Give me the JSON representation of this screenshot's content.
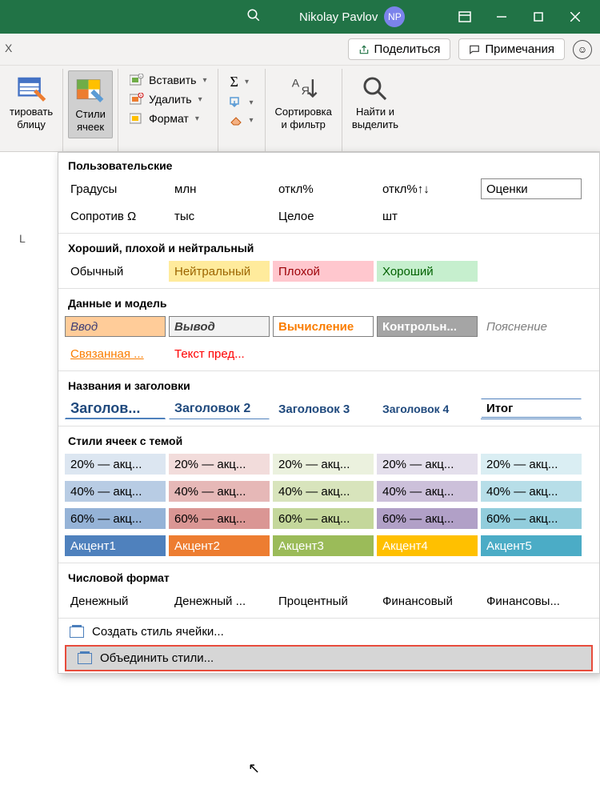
{
  "titlebar": {
    "user": "Nikolay Pavlov",
    "initials": "NP"
  },
  "top": {
    "share": "Поделиться",
    "comments": "Примечания",
    "x": "X"
  },
  "ribbon": {
    "format_table": "тировать\nблицу",
    "cell_styles": "Стили\nячеек",
    "insert": "Вставить",
    "delete": "Удалить",
    "format": "Формат",
    "sort": "Сортировка\nи фильтр",
    "find": "Найти и\nвыделить"
  },
  "col_l": "L",
  "sections": {
    "custom": "Пользовательские",
    "custom_row1": [
      "Градусы",
      "млн",
      "откл%",
      "откл%↑↓",
      "Оценки"
    ],
    "custom_row2": [
      "Сопротив Ω",
      "тыс",
      "Целое",
      "шт"
    ],
    "good_bad": "Хороший, плохой и нейтральный",
    "gbn": [
      "Обычный",
      "Нейтральный",
      "Плохой",
      "Хороший"
    ],
    "data_model": "Данные и модель",
    "dm1": [
      "Ввод",
      "Вывод",
      "Вычисление",
      "Контрольн...",
      "Пояснение"
    ],
    "dm2": [
      "Связанная ...",
      "Текст пред..."
    ],
    "titles": "Названия и заголовки",
    "t1": [
      "Заголов...",
      "Заголовок 2",
      "Заголовок 3",
      "Заголовок 4",
      "Итог"
    ],
    "themed": "Стили ячеек с темой",
    "th20": [
      "20% — акц...",
      "20% — акц...",
      "20% — акц...",
      "20% — акц...",
      "20% — акц..."
    ],
    "th40": [
      "40% — акц...",
      "40% — акц...",
      "40% — акц...",
      "40% — акц...",
      "40% — акц..."
    ],
    "th60": [
      "60% — акц...",
      "60% — акц...",
      "60% — акц...",
      "60% — акц...",
      "60% — акц..."
    ],
    "acc": [
      "Акцент1",
      "Акцент2",
      "Акцент3",
      "Акцент4",
      "Акцент5"
    ],
    "numfmt": "Числовой формат",
    "nf": [
      "Денежный",
      "Денежный ...",
      "Процентный",
      "Финансовый",
      "Финансовы..."
    ],
    "new_style": "Создать стиль ячейки...",
    "merge_styles": "Объединить стили..."
  }
}
